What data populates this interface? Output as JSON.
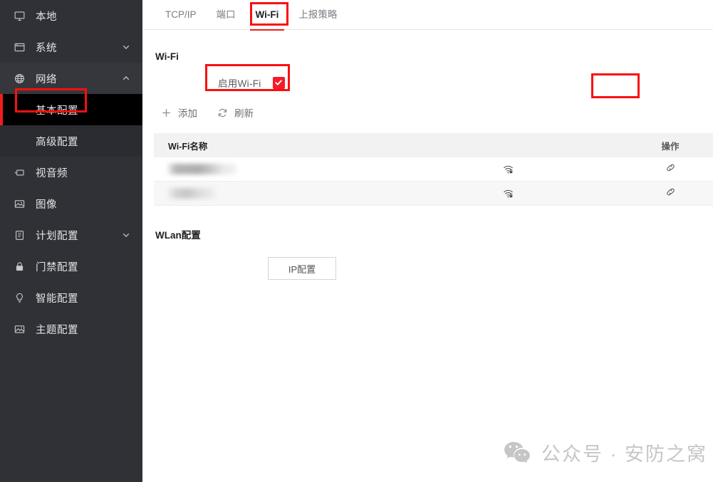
{
  "sidebar": {
    "items": [
      {
        "label": "本地",
        "icon": "monitor-icon",
        "expandable": false
      },
      {
        "label": "系统",
        "icon": "window-icon",
        "expandable": true,
        "chevron": "chevron-down-icon"
      },
      {
        "label": "网络",
        "icon": "globe-icon",
        "expandable": true,
        "chevron": "chevron-up-icon",
        "expanded": true
      },
      {
        "label": "视音频",
        "icon": "video-icon",
        "expandable": false
      },
      {
        "label": "图像",
        "icon": "image-icon",
        "expandable": false
      },
      {
        "label": "计划配置",
        "icon": "clipboard-icon",
        "expandable": true,
        "chevron": "chevron-down-icon"
      },
      {
        "label": "门禁配置",
        "icon": "lock-icon",
        "expandable": false
      },
      {
        "label": "智能配置",
        "icon": "bulb-icon",
        "expandable": false
      },
      {
        "label": "主题配置",
        "icon": "image-icon",
        "expandable": false
      }
    ],
    "network_submenu": [
      {
        "label": "基本配置",
        "active": true
      },
      {
        "label": "高级配置",
        "active": false
      }
    ]
  },
  "tabs": [
    {
      "label": "TCP/IP",
      "active": false
    },
    {
      "label": "端口",
      "active": false
    },
    {
      "label": "Wi-Fi",
      "active": true
    },
    {
      "label": "上报策略",
      "active": false
    }
  ],
  "main": {
    "section_title": "Wi-Fi",
    "enable_label": "启用Wi-Fi",
    "enable_checked": true,
    "toolbar": [
      {
        "label": "添加",
        "icon": "plus-icon"
      },
      {
        "label": "刷新",
        "icon": "refresh-icon"
      }
    ],
    "table": {
      "columns": [
        "Wi-Fi名称",
        "",
        "操作"
      ],
      "rows": [
        {
          "name": "",
          "name_redacted": true,
          "signal": "wifi-lock-icon",
          "action": "link-icon"
        },
        {
          "name": "",
          "name_redacted": true,
          "signal": "wifi-lock-icon",
          "action": "link-icon"
        }
      ]
    },
    "wlan_title": "WLan配置",
    "ip_button": "IP配置"
  },
  "watermark": {
    "text": "公众号 · 安防之窝",
    "icon": "wechat-icon"
  },
  "colors": {
    "accent_red": "#f01c1c",
    "annotation_red": "#fa0f10",
    "checkbox_red": "#f51b2a",
    "sidebar_bg": "#303136",
    "sidebar_active_bg": "#000000",
    "sidebar_sub_bg": "#2a2c31",
    "table_header_bg": "#f2f2f2",
    "watermark_gray": "#c6c6c6"
  }
}
